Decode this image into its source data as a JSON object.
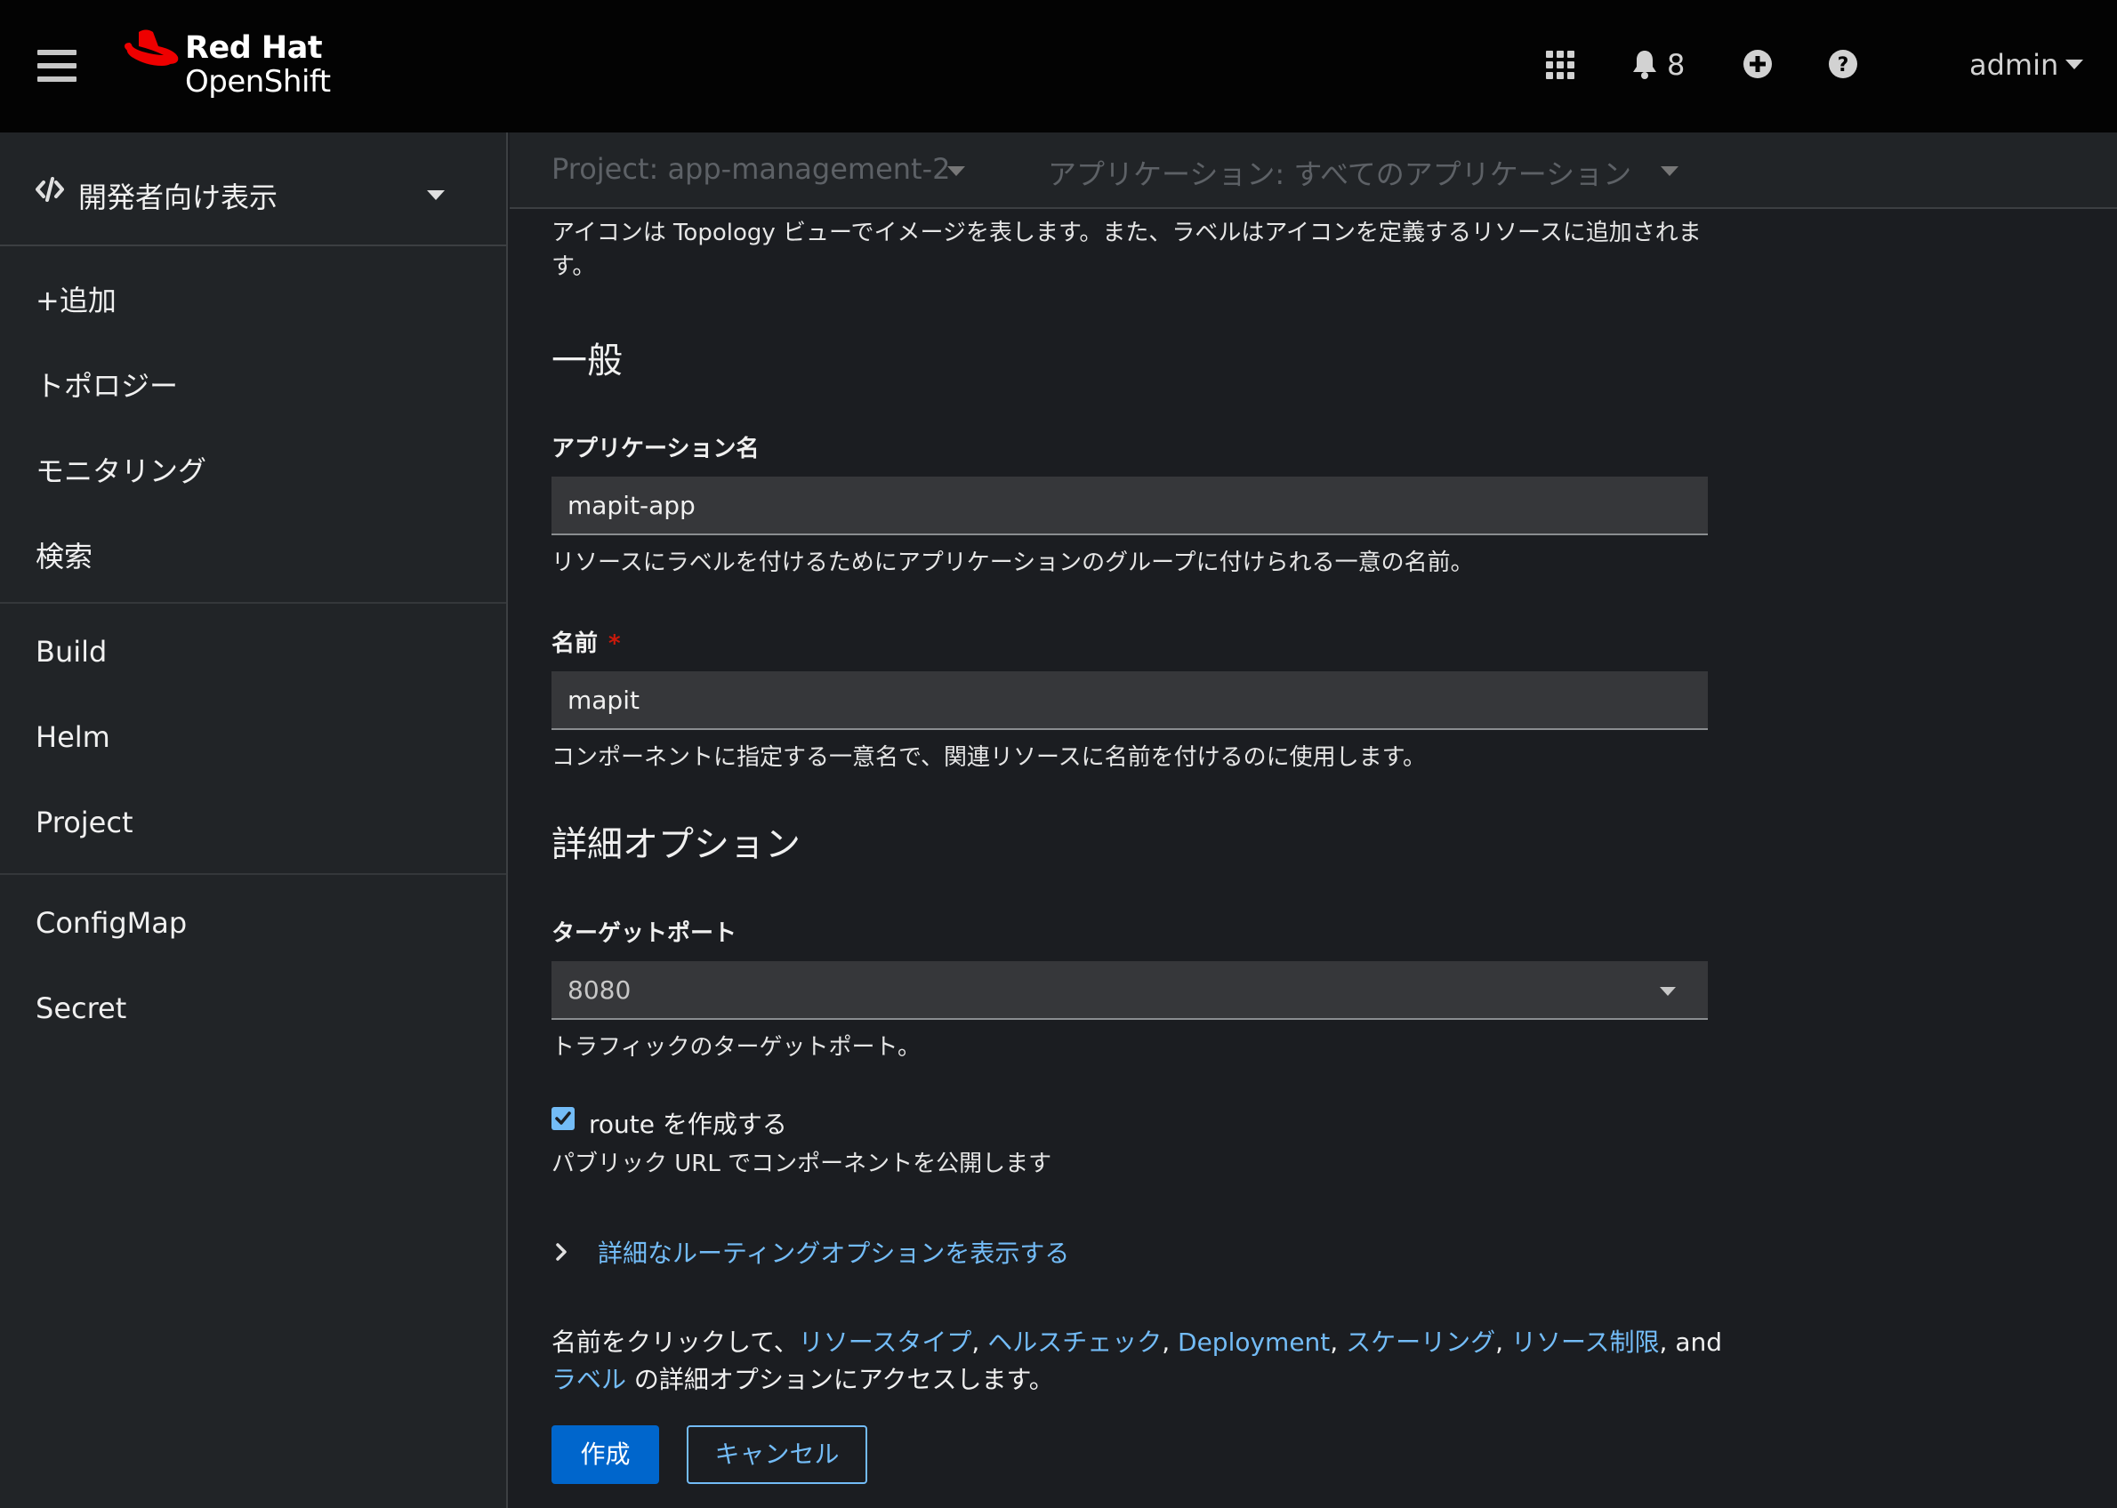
{
  "masthead": {
    "brand_line1": "Red Hat",
    "brand_line2": "OpenShift",
    "notification_count": "8",
    "user": "admin"
  },
  "sidebar": {
    "perspective": "開発者向け表示",
    "items": [
      "+追加",
      "トポロジー",
      "モニタリング",
      "検索",
      "Build",
      "Helm",
      "Project",
      "ConfigMap",
      "Secret"
    ]
  },
  "context": {
    "project": "Project: app-management-2",
    "application": "アプリケーション: すべてのアプリケーション"
  },
  "form": {
    "intro_line1": "アイコンは Topology ビューでイメージを表します。また、ラベルはアイコンを定義するリソースに追加されま",
    "intro_line2": "す。",
    "general_heading": "一般",
    "app_name_label": "アプリケーション名",
    "app_name_value": "mapit-app",
    "app_name_help": "リソースにラベルを付けるためにアプリケーションのグループに付けられる一意の名前。",
    "name_label": "名前",
    "name_required": "*",
    "name_value": "mapit",
    "name_help": "コンポーネントに指定する一意名で、関連リソースに名前を付けるのに使用します。",
    "advanced_heading": "詳細オプション",
    "target_port_label": "ターゲットポート",
    "target_port_value": "8080",
    "target_port_help": "トラフィックのターゲットポート。",
    "route_checkbox_label": "route を作成する",
    "route_checked": true,
    "route_help": "パブリック URL でコンポーネントを公開します",
    "routing_toggle": "詳細なルーティングオプションを表示する",
    "advanced_text_prefix": "名前をクリックして、",
    "advanced_links": [
      "リソースタイプ",
      "ヘルスチェック",
      "Deployment",
      "スケーリング",
      "リソース制限"
    ],
    "advanced_text_and": ", and",
    "advanced_link_labels": "ラベル",
    "advanced_text_suffix": " の詳細オプションにアクセスします。",
    "create_button": "作成",
    "cancel_button": "キャンセル"
  },
  "colors": {
    "masthead_bg": "#030303",
    "sidebar_bg": "#212427",
    "page_bg": "#1b1d21",
    "link": "#73bcf7",
    "primary": "#0066cc",
    "required": "#c9190b",
    "brand_red": "#ee0000"
  },
  "icons": [
    "hamburger-icon",
    "redhat-hat-icon",
    "app-launcher-icon",
    "bell-icon",
    "plus-circle-icon",
    "question-circle-icon",
    "code-icon",
    "chevron-right-icon",
    "caret-down-icon",
    "checkmark-icon"
  ]
}
